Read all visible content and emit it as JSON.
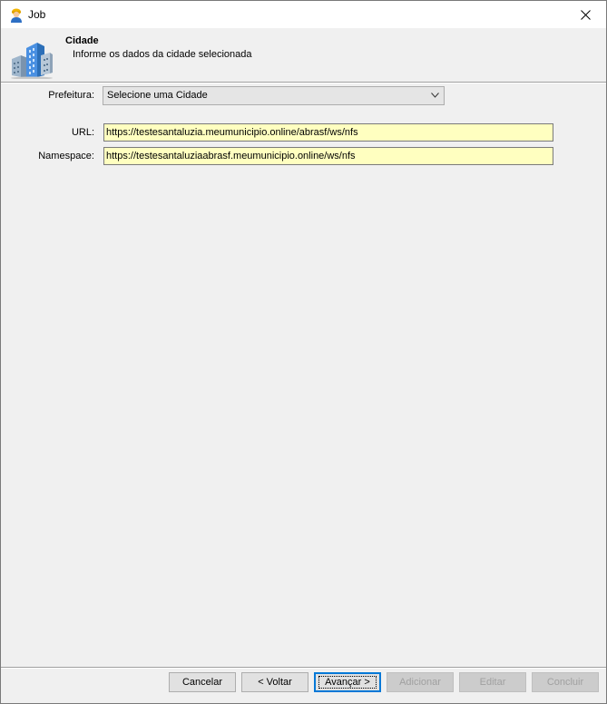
{
  "window": {
    "title": "Job",
    "close_icon": "close-icon",
    "app_icon": "user-worker-icon"
  },
  "header": {
    "title": "Cidade",
    "subtitle": "Informe os dados da cidade selecionada",
    "icon": "buildings-icon"
  },
  "form": {
    "prefeitura_label": "Prefeitura:",
    "prefeitura_value": "Selecione uma Cidade",
    "url_label": "URL:",
    "url_value": "https://testesantaluzia.meumunicipio.online/abrasf/ws/nfs",
    "namespace_label": "Namespace:",
    "namespace_value": "https://testesantaluziaabrasf.meumunicipio.online/ws/nfs",
    "field_bg_color": "#ffffc0"
  },
  "buttons": {
    "cancelar": "Cancelar",
    "voltar": "< Voltar",
    "avancar": "Avançar >",
    "adicionar": "Adicionar",
    "editar": "Editar",
    "concluir": "Concluir"
  }
}
